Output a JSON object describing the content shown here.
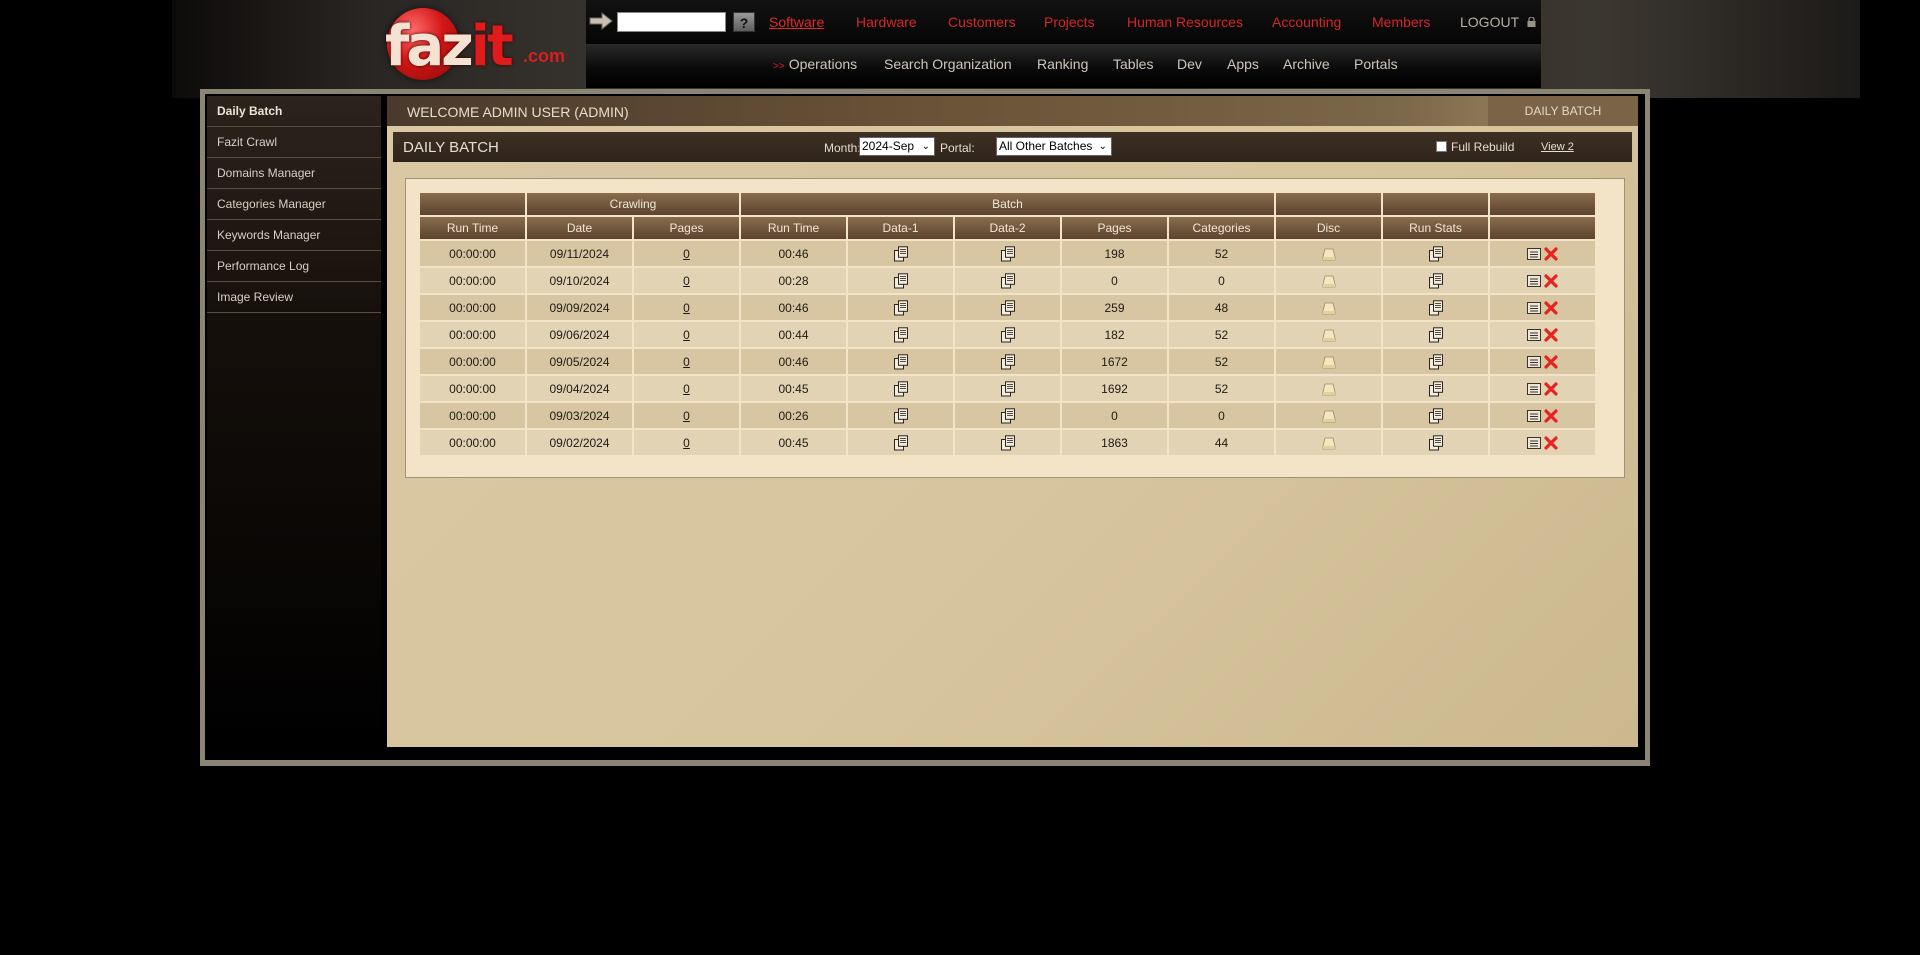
{
  "brand": {
    "logo_word_a": "faz",
    "logo_word_b": "it",
    "logo_suffix": ".com"
  },
  "header": {
    "search_placeholder": "",
    "help_label": "?",
    "top_nav": [
      "Software",
      "Hardware",
      "Customers",
      "Projects",
      "Human Resources",
      "Accounting",
      "Members"
    ],
    "active_top_nav": "Software",
    "logout_label": "LOGOUT",
    "sub_nav_arrow": ">>",
    "sub_nav": [
      "Operations",
      "Search Organization",
      "Ranking",
      "Tables",
      "Dev",
      "Apps",
      "Archive",
      "Portals"
    ]
  },
  "sidebar": {
    "items": [
      "Daily Batch",
      "Fazit Crawl",
      "Domains Manager",
      "Categories Manager",
      "Keywords Manager",
      "Performance Log",
      "Image Review"
    ],
    "active": "Daily Batch"
  },
  "main": {
    "welcome": "WELCOME ADMIN USER (ADMIN)",
    "breadcrumb": "DAILY BATCH",
    "section_title": "DAILY BATCH",
    "month_label": "Month:",
    "month_value": "2024-Sep",
    "portal_label": "Portal:",
    "portal_value": "All Other Batches",
    "full_rebuild_label": "Full Rebuild",
    "full_rebuild_checked": false,
    "view2_label": "View 2"
  },
  "table": {
    "group_headers": [
      "",
      "Crawling",
      "Batch",
      "",
      "",
      ""
    ],
    "columns": [
      "Run Time",
      "Date",
      "Pages",
      "Run Time",
      "Data-1",
      "Data-2",
      "Pages",
      "Categories",
      "Disc",
      "Run Stats",
      ""
    ],
    "rows": [
      {
        "crawl_time": "00:00:00",
        "date": "09/11/2024",
        "crawl_pages": "0",
        "batch_time": "00:46",
        "pages": "198",
        "categories": "52"
      },
      {
        "crawl_time": "00:00:00",
        "date": "09/10/2024",
        "crawl_pages": "0",
        "batch_time": "00:28",
        "pages": "0",
        "categories": "0"
      },
      {
        "crawl_time": "00:00:00",
        "date": "09/09/2024",
        "crawl_pages": "0",
        "batch_time": "00:46",
        "pages": "259",
        "categories": "48"
      },
      {
        "crawl_time": "00:00:00",
        "date": "09/06/2024",
        "crawl_pages": "0",
        "batch_time": "00:44",
        "pages": "182",
        "categories": "52"
      },
      {
        "crawl_time": "00:00:00",
        "date": "09/05/2024",
        "crawl_pages": "0",
        "batch_time": "00:46",
        "pages": "1672",
        "categories": "52"
      },
      {
        "crawl_time": "00:00:00",
        "date": "09/04/2024",
        "crawl_pages": "0",
        "batch_time": "00:45",
        "pages": "1692",
        "categories": "52"
      },
      {
        "crawl_time": "00:00:00",
        "date": "09/03/2024",
        "crawl_pages": "0",
        "batch_time": "00:26",
        "pages": "0",
        "categories": "0"
      },
      {
        "crawl_time": "00:00:00",
        "date": "09/02/2024",
        "crawl_pages": "0",
        "batch_time": "00:45",
        "pages": "1863",
        "categories": "44"
      }
    ]
  },
  "icons": {
    "arrow": "arrow-right-icon",
    "lock": "lock-icon",
    "copy": "copy-icon",
    "disc": "disc-icon",
    "edit": "edit-icon",
    "delete": "delete-icon"
  },
  "colors": {
    "nav_red": "#d62628",
    "panel_tan": "#d9c8a3",
    "header_brown": "#5a4330",
    "delete_red": "#e8221c"
  }
}
